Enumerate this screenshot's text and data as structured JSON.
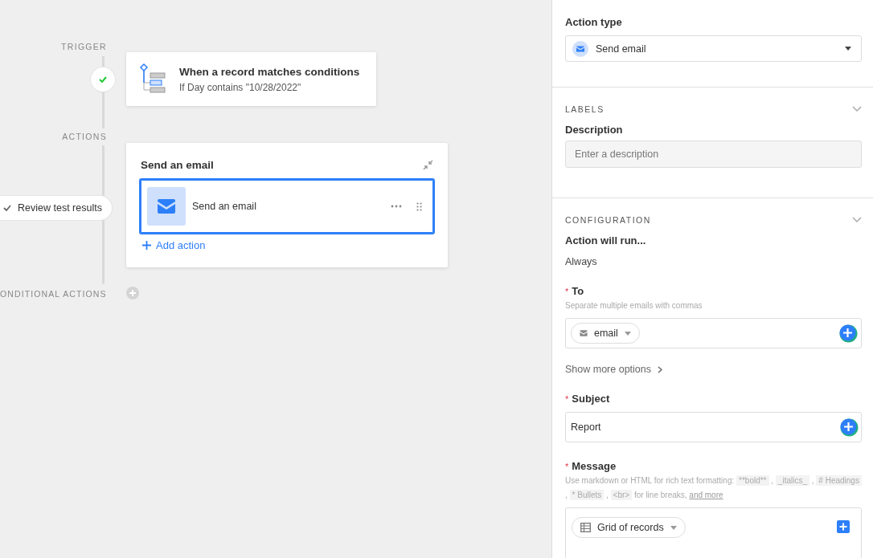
{
  "canvas": {
    "trigger": {
      "label": "TRIGGER",
      "title": "When a record matches conditions",
      "condition": "If Day contains \"10/28/2022\""
    },
    "actions": {
      "label": "ACTIONS",
      "title": "Send an email",
      "add_label": "Add action",
      "test_pill": "Review test results",
      "items": [
        {
          "name": "Send an email",
          "selected": true
        }
      ]
    },
    "conditional": {
      "label": "ONDITIONAL ACTIONS"
    }
  },
  "panel": {
    "action_type": {
      "label": "Action type",
      "value": "Send email"
    },
    "sections": [
      {
        "title": "LABELS",
        "fields": [
          {
            "kind": "input",
            "label": "Description",
            "placeholder": "Enter a description",
            "insert_button": false
          }
        ]
      },
      {
        "title": "CONFIGURATION",
        "fields": [
          {
            "kind": "static",
            "label": "Action will run...",
            "value": "Always"
          },
          {
            "kind": "token",
            "required_mark": "*",
            "label": "To",
            "hint": "Separate multiple emails with commas",
            "token": "email",
            "insert_button": true
          },
          {
            "kind": "link",
            "label": "Show more options"
          },
          {
            "kind": "input",
            "required_mark": "*",
            "label": "Subject",
            "value": "Report",
            "insert_button": true
          },
          {
            "kind": "message",
            "required_mark": "*",
            "label": "Message",
            "token": "Grid of records",
            "insert_button": true,
            "hint": [
              {
                "kind": "text",
                "text": "Use markdown or HTML for rich text formatting: "
              },
              {
                "kind": "code",
                "text": "**bold**"
              },
              {
                "kind": "text",
                "text": " , "
              },
              {
                "kind": "code",
                "text": "_italics_"
              },
              {
                "kind": "text",
                "text": " , "
              },
              {
                "kind": "code",
                "text": "# Headings"
              },
              {
                "kind": "text",
                "text": " , "
              },
              {
                "kind": "code",
                "text": "* Bullets"
              },
              {
                "kind": "text",
                "text": " , "
              },
              {
                "kind": "code",
                "text": "<br>"
              },
              {
                "kind": "text",
                "text": " for line breaks, "
              },
              {
                "kind": "link",
                "text": "and more"
              }
            ]
          }
        ]
      }
    ]
  }
}
